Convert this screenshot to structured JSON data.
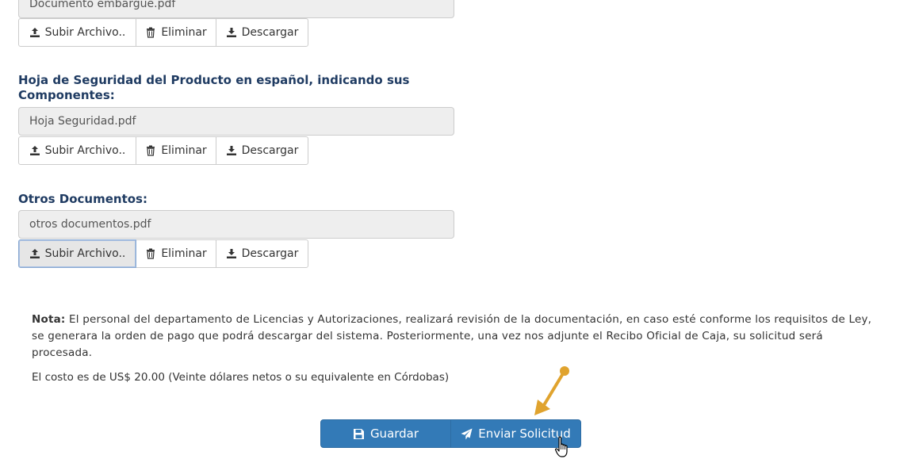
{
  "buttons": {
    "upload": "Subir Archivo..",
    "delete": "Eliminar",
    "download": "Descargar"
  },
  "sections": [
    {
      "label": "",
      "file": "Documento embargue.pdf"
    },
    {
      "label": "Hoja de Seguridad del Producto en español, indicando sus Componentes:",
      "file": "Hoja Seguridad.pdf"
    },
    {
      "label": "Otros Documentos:",
      "file": "otros documentos.pdf"
    }
  ],
  "note": {
    "prefix": "Nota:",
    "text": " El personal del departamento de Licencias y Autorizaciones, realizará revisión de la documentación, en caso esté conforme los requisitos de Ley, se generara la orden de pago que podrá descargar del sistema. Posteriormente, una vez nos adjunte el Recibo Oficial de Caja, su solicitud será procesada.",
    "cost": "El costo es de US$ 20.00 (Veinte dólares netos o su equivalente en Córdobas)"
  },
  "actions": {
    "save": "Guardar",
    "send": "Enviar Solicitud"
  },
  "icons": {
    "upload": "upload-icon",
    "delete": "trash-icon",
    "download": "download-icon",
    "save": "floppy-disk-icon",
    "send": "paper-plane-icon"
  },
  "colors": {
    "primary": "#337ab7",
    "label": "#1f3b62",
    "annotation_arrow": "#e0a32e"
  }
}
